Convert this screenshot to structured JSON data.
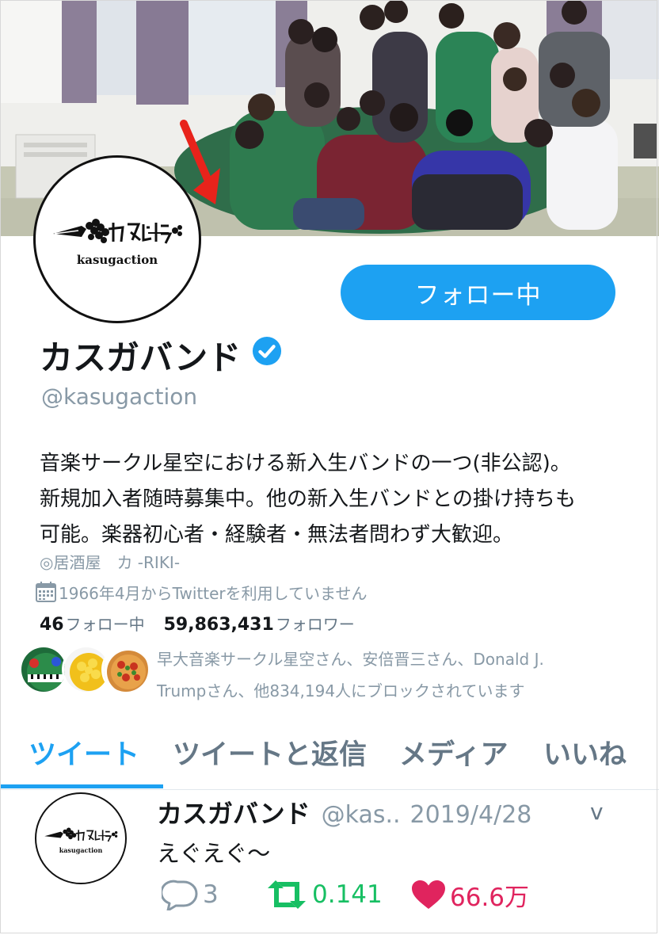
{
  "profile": {
    "logo_text": "kasugaction",
    "follow_button": "フォロー中",
    "display_name": "カスガバンド",
    "handle": "@kasugaction",
    "bio_lines": [
      "音楽サークル星空における新入生バンドの一つ(非公認)。",
      "新規加入者随時募集中。他の新入生バンドとの掛け持ちも",
      "可能。楽器初心者・経験者・無法者問わず大歓迎。"
    ],
    "location": "◎居酒屋　カ -RIKI-",
    "joined": "1966年4月からTwitterを利用していません",
    "following_count": "46",
    "following_label": "フォロー中",
    "followers_count": "59,863,431",
    "followers_label": "フォロワー",
    "blocked_lines": [
      "早大音楽サークル星空さん、安倍晋三さん、Donald J.",
      "Trumpさん、他834,194人にブロックされています"
    ]
  },
  "tabs": [
    "ツイート",
    "ツイートと返信",
    "メディア",
    "いいね"
  ],
  "tweet": {
    "name": "カスガバンド",
    "handle": "@kas..",
    "date": "2019/4/28",
    "caret": "v",
    "text": "えぐえぐ〜",
    "reply_count": "3",
    "retweet_count": "0.141",
    "like_count": "66.6万"
  },
  "colors": {
    "accent": "#1da1f2",
    "retweet": "#17bf63",
    "like": "#e0245e",
    "muted": "#8899a6",
    "arrow": "#e8231b"
  },
  "icons": [
    "verified-badge-icon",
    "calendar-icon",
    "reply-icon",
    "retweet-icon",
    "heart-icon",
    "red-arrow-icon"
  ]
}
